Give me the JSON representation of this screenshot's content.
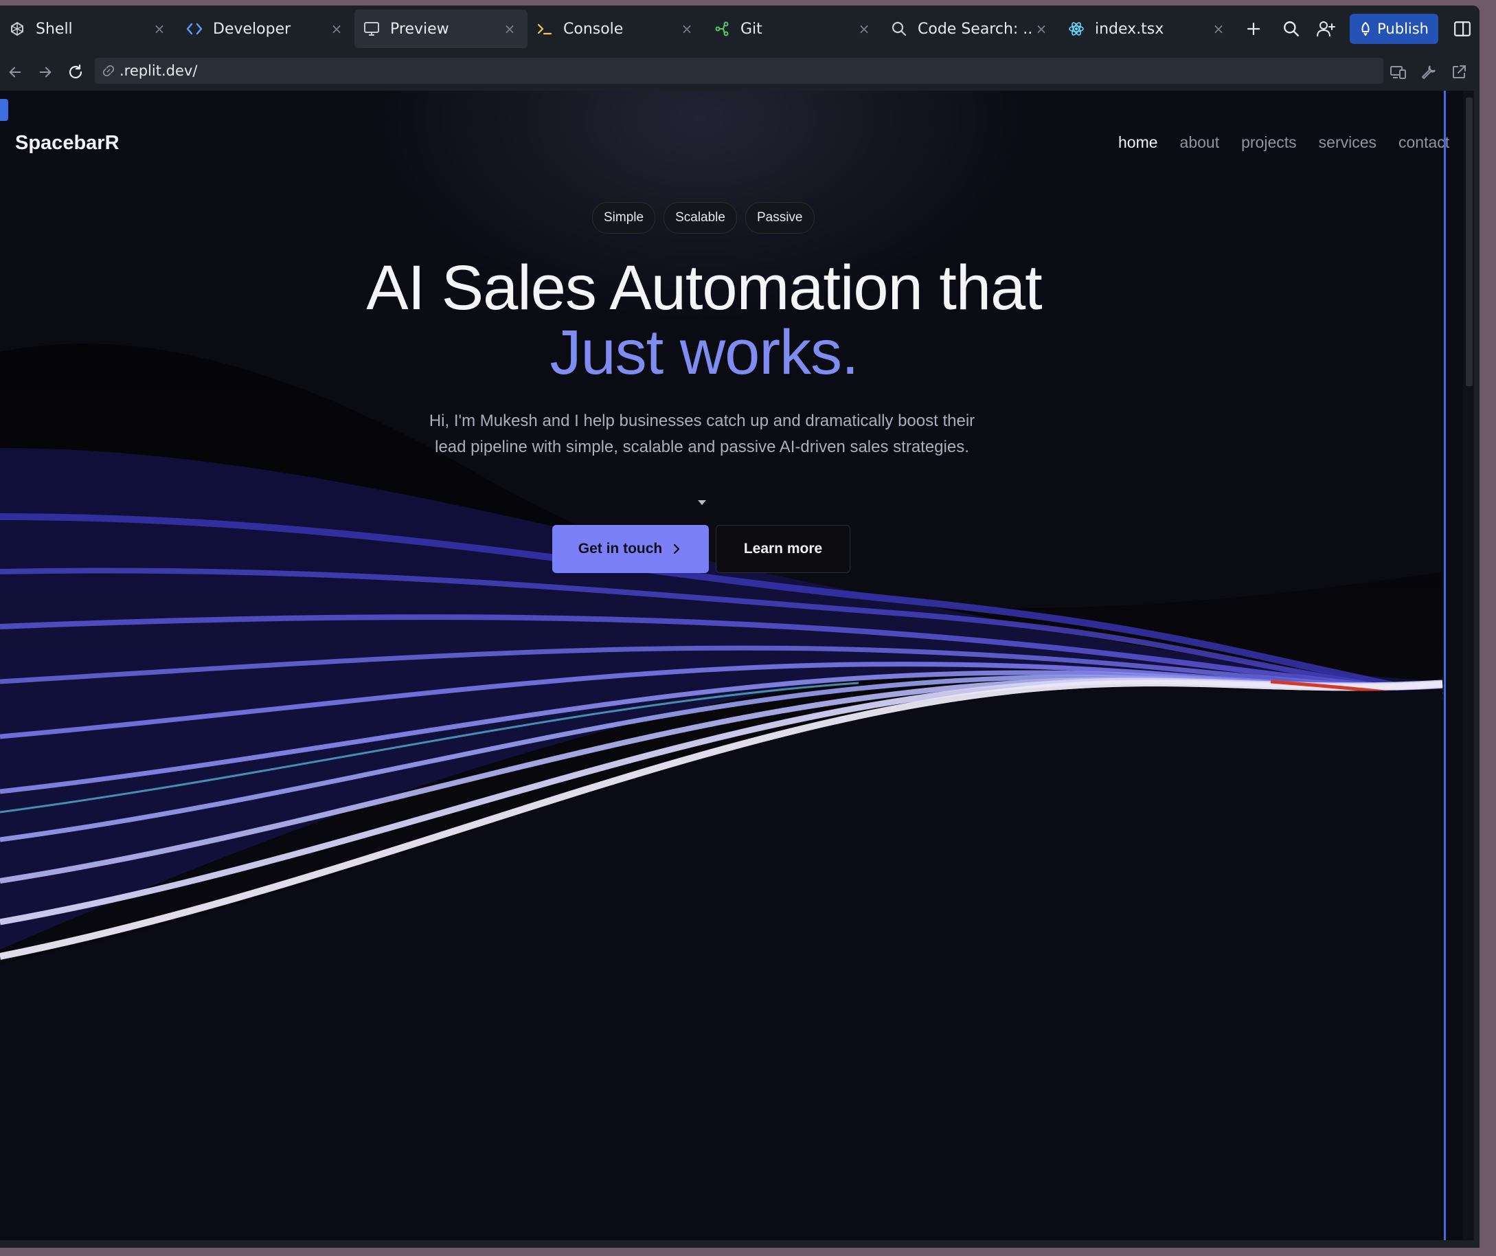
{
  "tabs": [
    {
      "label": "Shell",
      "icon": "shell-icon",
      "icon_color": "#c9ccd3"
    },
    {
      "label": "Developer",
      "icon": "code-icon",
      "icon_color": "#5aa0ff"
    },
    {
      "label": "Preview",
      "icon": "monitor-icon",
      "icon_color": "#c9ccd3",
      "active": true
    },
    {
      "label": "Console",
      "icon": "terminal-icon",
      "icon_color": "#f5c35a"
    },
    {
      "label": "Git",
      "icon": "git-branch-icon",
      "icon_color": "#58c76a"
    },
    {
      "label": "Code Search: ...",
      "icon": "search-icon",
      "icon_color": "#c9ccd3"
    },
    {
      "label": "index.tsx",
      "icon": "react-icon",
      "icon_color": "#61dafb"
    }
  ],
  "tab_close_glyph": "×",
  "toolbar": {
    "publish_label": "Publish"
  },
  "address": {
    "url": ".replit.dev/"
  },
  "site": {
    "brand": "SpacebarR",
    "nav": [
      "home",
      "about",
      "projects",
      "services",
      "contact"
    ],
    "pills": [
      "Simple",
      "Scalable",
      "Passive"
    ],
    "headline_line1": "AI Sales Automation that",
    "headline_line2": "Just works.",
    "subtitle": "Hi, I'm Mukesh and I help businesses catch up and dramatically boost their lead pipeline with simple, scalable and passive AI-driven sales strategies.",
    "primary_cta": "Get in touch",
    "secondary_cta": "Learn more"
  },
  "colors": {
    "accent": "#7c80f6",
    "headline_accent": "#7f8cf0",
    "publish": "#2553b5",
    "focus_line": "#3b6fe0"
  }
}
